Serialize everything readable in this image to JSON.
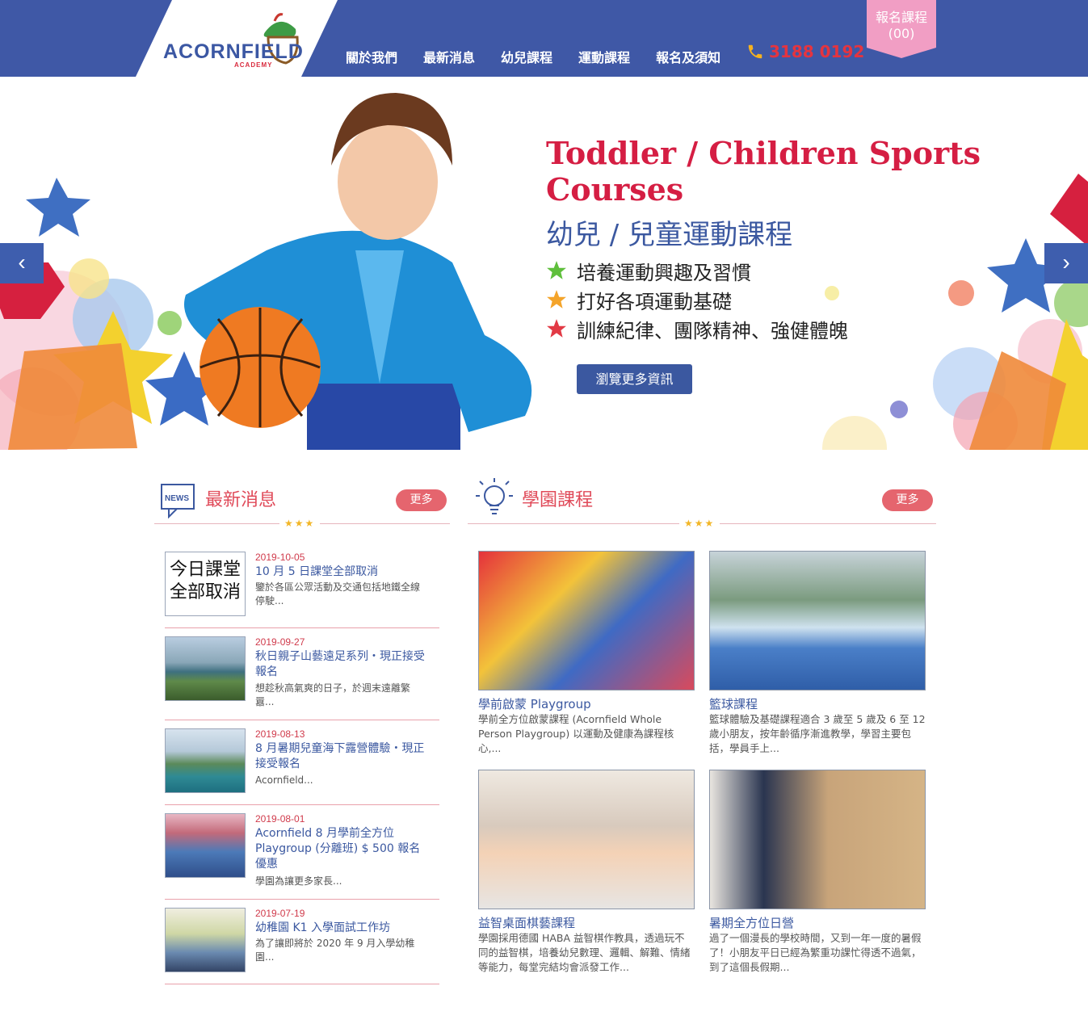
{
  "header": {
    "logo_text": "ACORNFIELD",
    "logo_sub": "ACADEMY",
    "nav": [
      "關於我們",
      "最新消息",
      "幼兒課程",
      "運動課程",
      "報名及須知"
    ],
    "phone": "3188 0192",
    "enroll_label": "報名課程",
    "enroll_count": "(00)",
    "colors": {
      "bar": "#3f58a6",
      "enroll": "#f19ec4",
      "phone": "#e5343f"
    }
  },
  "hero": {
    "title": "Toddler / Children Sports Courses",
    "subtitle": "幼兒 / 兒童運動課程",
    "bullets": [
      {
        "text": "培養運動興趣及習慣",
        "icon": "star-green-icon"
      },
      {
        "text": "打好各項運動基礎",
        "icon": "star-orange-icon"
      },
      {
        "text": "訓練紀律、團隊精神、強健體魄",
        "icon": "star-red-icon"
      }
    ],
    "button": "瀏覽更多資訊",
    "prev_icon": "‹",
    "next_icon": "›"
  },
  "news": {
    "title": "最新消息",
    "icon_text": "NEWS",
    "more": "更多",
    "items": [
      {
        "date": "2019-10-05",
        "title": "10 月 5 日課堂全部取消",
        "desc": "鑒於各區公眾活動及交通包括地鐵全線停駛...",
        "thumb_text": [
          "今日課堂",
          "全部取消"
        ]
      },
      {
        "date": "2019-09-27",
        "title": "秋日親子山藝遠足系列・現正接受報名",
        "desc": "想趁秋高氣爽的日子，於週末遠離繁囂..."
      },
      {
        "date": "2019-08-13",
        "title": "8 月暑期兒童海下露營體驗・現正接受報名",
        "desc": "Acornfield..."
      },
      {
        "date": "2019-08-01",
        "title": "Acornfield 8 月學前全方位 Playgroup (分離班) $ 500 報名優惠",
        "desc": "學園為讓更多家長..."
      },
      {
        "date": "2019-07-19",
        "title": "幼稚園 K1 入學面試工作坊",
        "desc": "為了讓即將於 2020 年 9 月入學幼稚園..."
      }
    ]
  },
  "courses": {
    "title": "學園課程",
    "more": "更多",
    "items": [
      {
        "title": "學前啟蒙 Playgroup",
        "desc": "學前全方位啟蒙課程 (Acornfield Whole Person Playgroup) 以運動及健康為課程核心,..."
      },
      {
        "title": "籃球課程",
        "desc": "籃球體驗及基礎課程適合 3 歲至 5 歲及 6 至 12 歲小朋友，按年齡循序漸進教學，學習主要包括，學員手上..."
      },
      {
        "title": "益智桌面棋藝課程",
        "desc": "學園採用德國 HABA 益智棋作教具，透過玩不同的益智棋，培養幼兒數理、邏輯、解難、情緒等能力，每堂完結均會派發工作..."
      },
      {
        "title": "暑期全方位日營",
        "desc": "過了一個漫長的學校時間，又到一年一度的暑假了！小朋友平日已經為繁重功課忙得透不過氣，到了這個長假期..."
      }
    ]
  }
}
